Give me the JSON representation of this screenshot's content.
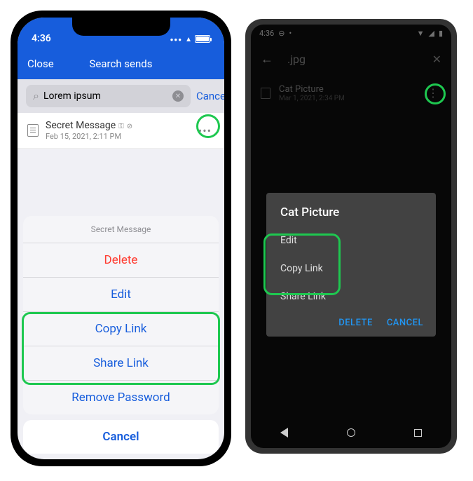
{
  "ios": {
    "statusbar": {
      "time": "4:36"
    },
    "header": {
      "close": "Close",
      "title": "Search sends"
    },
    "search": {
      "value": "Lorem ipsum",
      "cancel": "Cancel"
    },
    "item": {
      "title": "Secret Message",
      "subtitle": "Feb 15, 2021, 2:11 PM"
    },
    "sheet": {
      "header": "Secret Message",
      "delete": "Delete",
      "edit": "Edit",
      "copylink": "Copy Link",
      "sharelink": "Share Link",
      "removepw": "Remove Password",
      "cancel": "Cancel"
    }
  },
  "android": {
    "statusbar": {
      "time": "4:36"
    },
    "header": {
      "title": ".jpg"
    },
    "item": {
      "title": "Cat Picture",
      "subtitle": "Mar 1, 2021, 2:34 PM"
    },
    "dialog": {
      "title": "Cat Picture",
      "edit": "Edit",
      "copylink": "Copy Link",
      "sharelink": "Share Link",
      "delete": "DELETE",
      "cancel": "CANCEL"
    }
  }
}
